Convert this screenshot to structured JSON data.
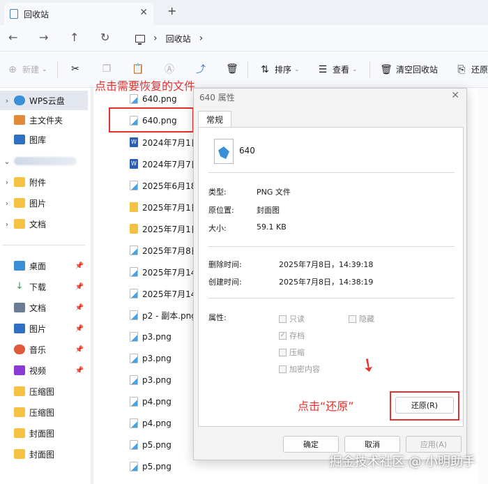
{
  "window": {
    "tab_title": "回收站",
    "close_tab": "✕",
    "new_tab": "+"
  },
  "nav": {
    "back": "←",
    "forward": "→",
    "up": "↑",
    "refresh": "↻",
    "location": "回收站",
    "chevron": "›"
  },
  "toolbar": {
    "new_label": "新建",
    "sort_label": "排序",
    "view_label": "查看",
    "empty_label": "清空回收站",
    "restore_label": "还原"
  },
  "sidebar": {
    "items": [
      {
        "label": "WPS云盘",
        "arrow": "›"
      },
      {
        "label": "主文件夹",
        "arrow": ""
      },
      {
        "label": "图库",
        "arrow": ""
      },
      {
        "label": "",
        "arrow": "⌄"
      },
      {
        "label": "附件",
        "arrow": "›"
      },
      {
        "label": "图片",
        "arrow": "›"
      },
      {
        "label": "文档",
        "arrow": "›"
      },
      {
        "label": "桌面",
        "arrow": ""
      },
      {
        "label": "下载",
        "arrow": ""
      },
      {
        "label": "文档",
        "arrow": ""
      },
      {
        "label": "图片",
        "arrow": ""
      },
      {
        "label": "音乐",
        "arrow": ""
      },
      {
        "label": "视频",
        "arrow": ""
      },
      {
        "label": "压缩图",
        "arrow": ""
      },
      {
        "label": "压缩图",
        "arrow": ""
      },
      {
        "label": "封面图",
        "arrow": ""
      },
      {
        "label": "封面图",
        "arrow": ""
      }
    ]
  },
  "files": [
    {
      "name": "640.png",
      "type": "png"
    },
    {
      "name": "640.png",
      "type": "png"
    },
    {
      "name": "2024年7月1日",
      "type": "word"
    },
    {
      "name": "2024年7月7日",
      "type": "word"
    },
    {
      "name": "2025年6月18日",
      "type": "png"
    },
    {
      "name": "2025年7月1日",
      "type": "folder"
    },
    {
      "name": "2025年7月1日",
      "type": "folder"
    },
    {
      "name": "2025年7月8日",
      "type": "png"
    },
    {
      "name": "2025年7月14日",
      "type": "png"
    },
    {
      "name": "2025年7月14日",
      "type": "png"
    },
    {
      "name": "p2 - 副本.png",
      "type": "png"
    },
    {
      "name": "p3.png",
      "type": "png"
    },
    {
      "name": "p3.png",
      "type": "png"
    },
    {
      "name": "p3.png",
      "type": "png"
    },
    {
      "name": "p4.png",
      "type": "png"
    },
    {
      "name": "p4.png",
      "type": "png"
    },
    {
      "name": "p5.png",
      "type": "png"
    },
    {
      "name": "p5.png",
      "type": "png"
    }
  ],
  "annotations": {
    "click_file": "点击需要恢复的文件",
    "click_restore": "点击“还原”"
  },
  "dialog": {
    "title": "640 属性",
    "close": "✕",
    "tab": "常规",
    "filename": "640",
    "type_label": "类型:",
    "type_value": "PNG 文件",
    "origin_label": "原位置:",
    "origin_value": "封面图",
    "size_label": "大小:",
    "size_value": "59.1 KB",
    "deleted_label": "删除时间:",
    "deleted_value": "2025年7月8日，14:39:18",
    "created_label": "创建时间:",
    "created_value": "2025年7月8日，14:38:19",
    "attr_label": "属性:",
    "readonly": "只读",
    "hidden": "隐藏",
    "archive": "存档",
    "compress": "压缩",
    "encrypt": "加密内容",
    "restore_btn": "还原(R)",
    "ok_btn": "确定",
    "cancel_btn": "取消",
    "apply_btn": "应用(A)"
  },
  "watermark": "掘金技术社区 @ 小明助手",
  "colors": {
    "annotation": "#e5322d",
    "folder": "#f6c243"
  }
}
